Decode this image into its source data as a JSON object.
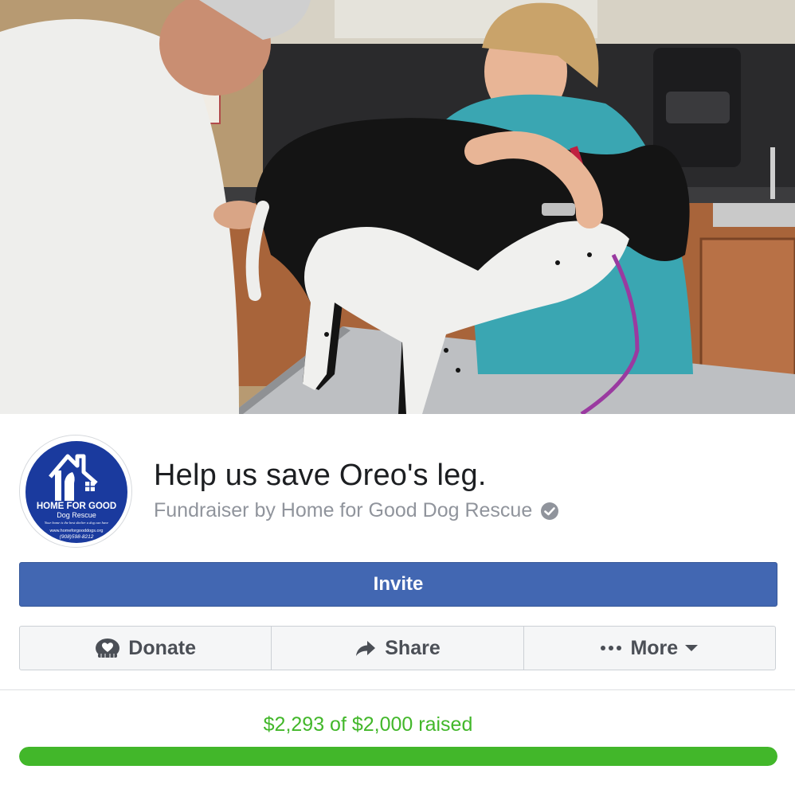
{
  "fundraiser": {
    "title": "Help us save Oreo's leg.",
    "subtitle": "Fundraiser by Home for Good Dog Rescue",
    "organization_logo": {
      "name": "HOME FOR GOOD",
      "tagline": "Dog Rescue",
      "motto": "Your home is the best shelter a dog can have",
      "website": "www.homeforgooddogs.org",
      "phone": "(908)598-8212"
    }
  },
  "buttons": {
    "invite_label": "Invite",
    "donate_label": "Donate",
    "share_label": "Share",
    "more_label": "More"
  },
  "progress": {
    "raised_text": "$2,293 of $2,000 raised",
    "raised_amount": 2293,
    "goal_amount": 2000,
    "fill_fraction": 1.0
  },
  "colors": {
    "invite_bg": "#4267b2",
    "progress_green": "#42b72a",
    "logo_blue": "#1a3a9e"
  },
  "icons": {
    "donate": "donate-heart-icon",
    "share": "share-arrow-icon",
    "more": "ellipsis-icon",
    "more_caret": "caret-down-icon",
    "verified": "verified-badge-icon"
  }
}
